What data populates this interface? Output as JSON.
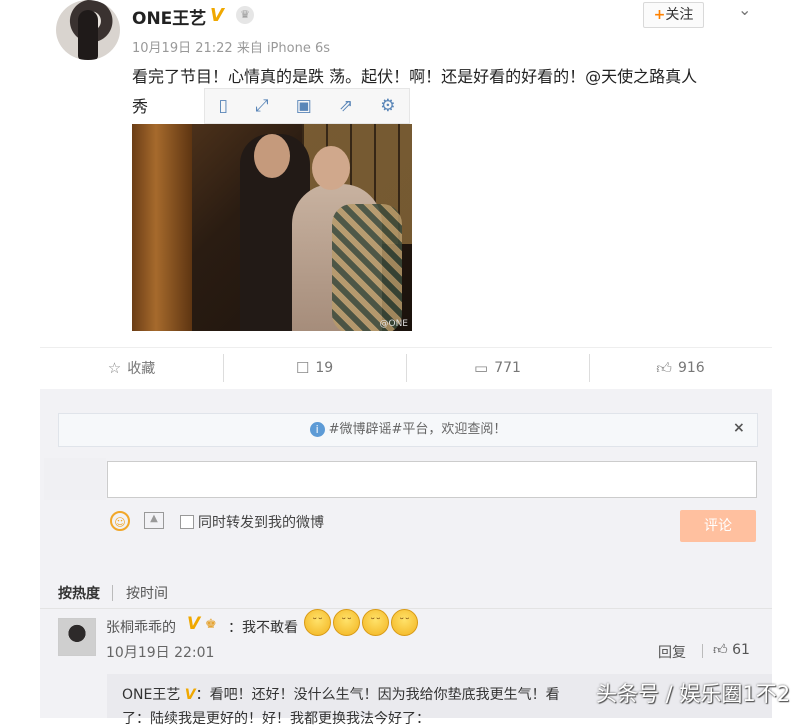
{
  "post": {
    "author": "ONE王艺",
    "verified_badge": "V",
    "follow_label": "关注",
    "meta": "10月19日 21:22 来自 iPhone 6s",
    "text": "看完了节目！心情真的是跌 荡。起伏！啊！还是好看的好看的！@天使之路真人",
    "text_line2": "秀",
    "image_watermark": "@ONE"
  },
  "actions": {
    "favorite_label": "收藏",
    "repost_count": "19",
    "comment_count": "771",
    "like_count": "916"
  },
  "notice": {
    "text": "#微博辟谣#平台，欢迎查阅！",
    "close": "×"
  },
  "composer": {
    "forward_label": "同时转发到我的微博",
    "submit_label": "评论"
  },
  "sort": {
    "by_heat": "按热度",
    "by_time": "按时间"
  },
  "comment": {
    "user": "张桐乖乖的",
    "badge": "V",
    "text": "：我不敢看",
    "time": "10月19日 22:01",
    "reply_label": "回复",
    "likes": "61"
  },
  "subcomment": {
    "author": "ONE王艺",
    "badge": "V",
    "text": "：看吧！还好！没什么生气！因为我给你垫底我更生气！看",
    "line2": "了：陆续我是更好的！好！我都更换我法今好了：",
    "watermark": "头条号 / 娱乐圈1不2"
  },
  "icons": {
    "favorite": "star-icon",
    "repost": "repost-icon",
    "comment": "comment-icon",
    "like": "thumbs-up-icon"
  }
}
